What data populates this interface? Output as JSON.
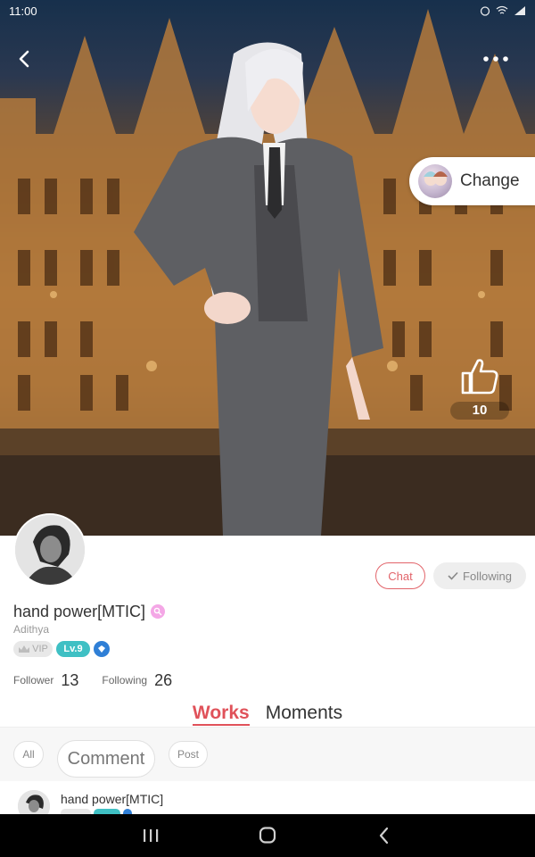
{
  "status_bar": {
    "time": "11:00"
  },
  "hero": {
    "change_label": "Change",
    "like_count": "10"
  },
  "profile": {
    "name": "hand power[MTIC]",
    "user_id": "Adithya",
    "vip_label": "VIP",
    "level_label": "Lv.9",
    "chat_label": "Chat",
    "following_button_label": "Following",
    "follower_label": "Follower",
    "follower_count": "13",
    "following_label": "Following",
    "following_count": "26"
  },
  "tabs": [
    {
      "label": "Works",
      "active": true
    },
    {
      "label": "Moments",
      "active": false
    }
  ],
  "filters": [
    {
      "label": "All"
    },
    {
      "label": "Comment"
    },
    {
      "label": "Post"
    }
  ],
  "post": {
    "author": "hand power[MTIC]"
  },
  "colors": {
    "accent": "#e0525a",
    "level": "#3fc0c4",
    "gem": "#2f7fd6"
  },
  "icons": {
    "back": "back-arrow-icon",
    "more": "more-dots-icon",
    "like": "thumbs-up-icon",
    "nav_recents": "recents-icon",
    "nav_home": "home-icon",
    "nav_back": "nav-back-icon"
  }
}
